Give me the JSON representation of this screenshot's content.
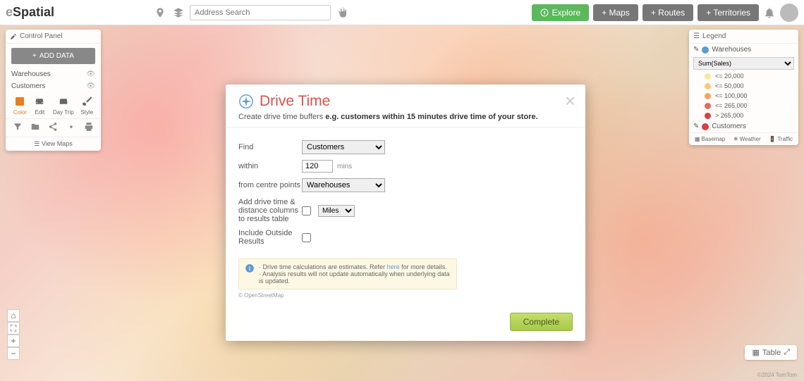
{
  "header": {
    "logo_prefix": "e",
    "logo_main": "Spatial",
    "search_placeholder": "Address Search",
    "explore": "Explore",
    "maps": "+ Maps",
    "routes": "+ Routes",
    "territories": "+ Territories"
  },
  "control_panel": {
    "title": "Control Panel",
    "add_data": "ADD DATA",
    "layer1": "Warehouses",
    "layer2": "Customers",
    "tool_color": "Color",
    "tool_edit": "Edit",
    "tool_daytrip": "Day Trip",
    "tool_style": "Style",
    "view_maps": "View Maps"
  },
  "legend": {
    "title": "Legend",
    "layer_warehouses": "Warehouses",
    "select_value": "Sum(Sales)",
    "items": [
      {
        "label": "<= 20,000",
        "color": "#fce79a"
      },
      {
        "label": "<= 50,000",
        "color": "#f9c978"
      },
      {
        "label": "<= 100,000",
        "color": "#f4a460"
      },
      {
        "label": "<= 265,000",
        "color": "#e66a5a"
      },
      {
        "label": "> 265,000",
        "color": "#d94040"
      }
    ],
    "layer_customers": "Customers",
    "basemap": "Basemap",
    "weather": "Weather",
    "traffic": "Traffic"
  },
  "modal": {
    "title": "Drive Time",
    "subtitle_plain": "Create drive time buffers ",
    "subtitle_bold": "e.g. customers within 15 minutes drive time of your store.",
    "find_label": "Find",
    "find_value": "Customers",
    "within_label": "within",
    "within_value": "120",
    "mins": "mins",
    "from_label": "from centre points",
    "from_value": "Warehouses",
    "add_cols_label": "Add drive time & distance columns to results table",
    "units_value": "Miles",
    "include_label": "Include Outside Results",
    "info_line1_a": "· Drive time calculations are estimates. Refer ",
    "info_link": "here",
    "info_line1_b": " for more details.",
    "info_line2": "· Analysis results will not update automatically when underlying data is updated.",
    "osm": "© OpenStreetMap",
    "complete": "Complete"
  },
  "bottom": {
    "table": "Table",
    "attribution": "©2024 TomTom"
  }
}
